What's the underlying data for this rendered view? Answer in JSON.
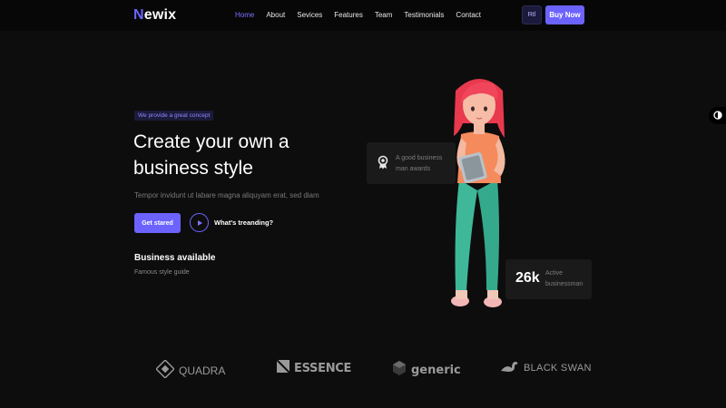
{
  "header": {
    "logo_mark": "N",
    "logo_rest": "ewix",
    "nav": [
      "Home",
      "About",
      "Sevices",
      "Features",
      "Team",
      "Testimonials",
      "Contact"
    ],
    "rtl_label": "Rtl",
    "buy_label": "Buy Now"
  },
  "hero": {
    "badge": "We provide a great concept",
    "title": "Create your own a business style",
    "subtitle": "Tempor invidunt ut labare magna aliquyam erat, sed diam",
    "cta_label": "Get stared",
    "trending_label": "What's treanding?",
    "business_title": "Business available",
    "business_sub": "Famous style guide"
  },
  "cards": {
    "award_text": "A good business man awards",
    "stat_number": "26k",
    "stat_label": "Active businessman"
  },
  "brands": [
    "QUADRA",
    "ESSENCE",
    "generic",
    "BLACK SWAN"
  ],
  "colors": {
    "accent": "#6c63ff",
    "background": "#0d0d0d",
    "header_bg": "#070707",
    "card_bg": "#1a1a1a"
  }
}
